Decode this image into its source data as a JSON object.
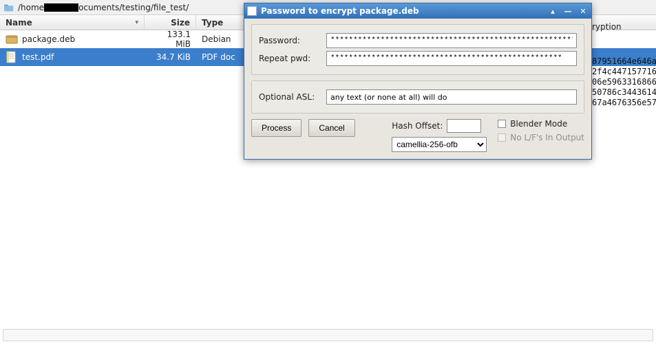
{
  "fm": {
    "path_prefix": "/home",
    "path_suffix": "ocuments/testing/file_test/",
    "columns": {
      "name": "Name",
      "size": "Size",
      "type": "Type"
    },
    "rows": [
      {
        "icon": "package-icon",
        "name": "package.deb",
        "size": "133.1 MiB",
        "type": "Debian",
        "selected": false
      },
      {
        "icon": "pdf-icon",
        "name": "test.pdf",
        "size": "34.7 KiB",
        "type": "PDF doc",
        "selected": true
      }
    ]
  },
  "dialog": {
    "title": "Password to encrypt package.deb",
    "labels": {
      "password": "Password:",
      "repeat": "Repeat pwd:",
      "asl": "Optional ASL:"
    },
    "values": {
      "password": "*******************************************************",
      "repeat": "***************************************************",
      "asl": "any text (or none at all) will do"
    },
    "buttons": {
      "process": "Process",
      "cancel": "Cancel"
    },
    "hash_label": "Hash Offset:",
    "hash_value": "",
    "cipher_selected": "camellia-256-ofb",
    "cipher_options": [
      "camellia-256-ofb"
    ],
    "checks": {
      "blender": "Blender Mode",
      "nolf": "No L/F's In Output"
    }
  },
  "bg": {
    "header_fragment": "ryption",
    "hash_lines": [
      "87951664e646a",
      "2f4c447157716",
      "06e5963316866",
      "50786c3443614",
      "67a4676356e57"
    ]
  }
}
